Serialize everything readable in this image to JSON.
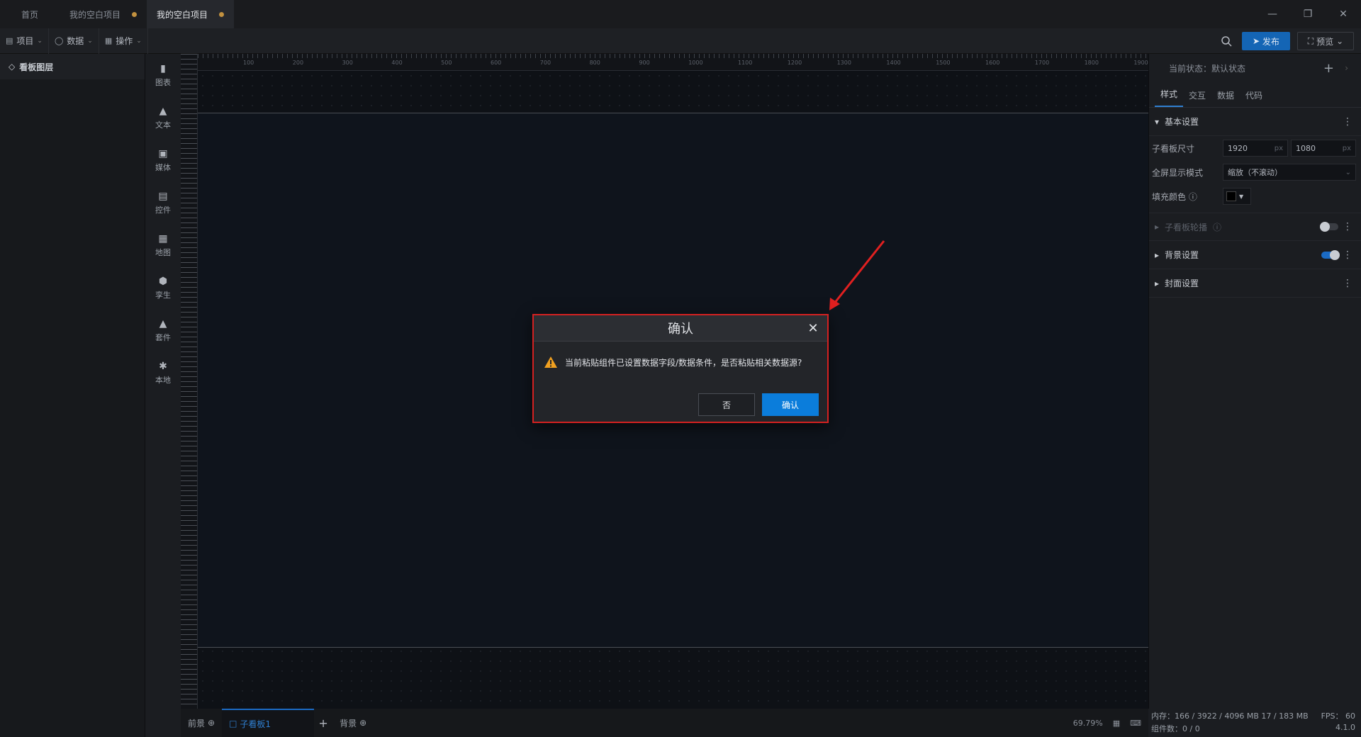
{
  "tabs": [
    {
      "label": "首页",
      "modified": false
    },
    {
      "label": "我的空白项目",
      "modified": true
    },
    {
      "label": "我的空白项目",
      "modified": true
    }
  ],
  "toolbar": {
    "menus": [
      {
        "label": "项目",
        "icon": "file-icon"
      },
      {
        "label": "数据",
        "icon": "database-icon"
      },
      {
        "label": "操作",
        "icon": "grid-icon"
      }
    ],
    "publish_label": "发布",
    "preview_label": "预览"
  },
  "layers": {
    "title": "看板图层"
  },
  "components": [
    {
      "label": "图表",
      "icon": "chart-icon"
    },
    {
      "label": "文本",
      "icon": "text-icon"
    },
    {
      "label": "媒体",
      "icon": "media-icon"
    },
    {
      "label": "控件",
      "icon": "control-icon"
    },
    {
      "label": "地图",
      "icon": "map-icon"
    },
    {
      "label": "孪生",
      "icon": "twin-icon"
    },
    {
      "label": "套件",
      "icon": "kit-icon"
    },
    {
      "label": "本地",
      "icon": "local-icon"
    }
  ],
  "ruler_marks": [
    "100",
    "200",
    "300",
    "400",
    "500",
    "600",
    "700",
    "800",
    "900",
    "1000",
    "1100",
    "1200",
    "1300",
    "1400",
    "1500",
    "1600",
    "1700",
    "1800",
    "1900"
  ],
  "bottom": {
    "foreground": "前景",
    "subboard": "子看板1",
    "background": "背景",
    "zoom": "69.79%"
  },
  "props": {
    "state_label": "当前状态：",
    "state_value": "默认状态",
    "tabs": [
      "样式",
      "交互",
      "数据",
      "代码"
    ],
    "basic_section": "基本设置",
    "size_label": "子看板尺寸",
    "width": "1920",
    "height": "1080",
    "unit": "px",
    "fullscreen_label": "全屏显示模式",
    "fullscreen_value": "缩放（不滚动）",
    "fill_label": "填充颜色",
    "carousel_section": "子看板轮播",
    "background_section": "背景设置",
    "cover_section": "封面设置"
  },
  "status": {
    "memory": "内存：166 / 3922 / 4096 MB 17 / 183 MB",
    "fps": "FPS： 60",
    "components": "组件数：0 / 0",
    "version": "4.1.0"
  },
  "dialog": {
    "title": "确认",
    "message": "当前粘贴组件已设置数据字段/数据条件，是否粘贴相关数据源?",
    "no_label": "否",
    "ok_label": "确认"
  },
  "colors": {
    "accent": "#0b7ddb",
    "highlight_border": "#d42121",
    "arrow": "#e02020",
    "warning": "#f0a020"
  }
}
